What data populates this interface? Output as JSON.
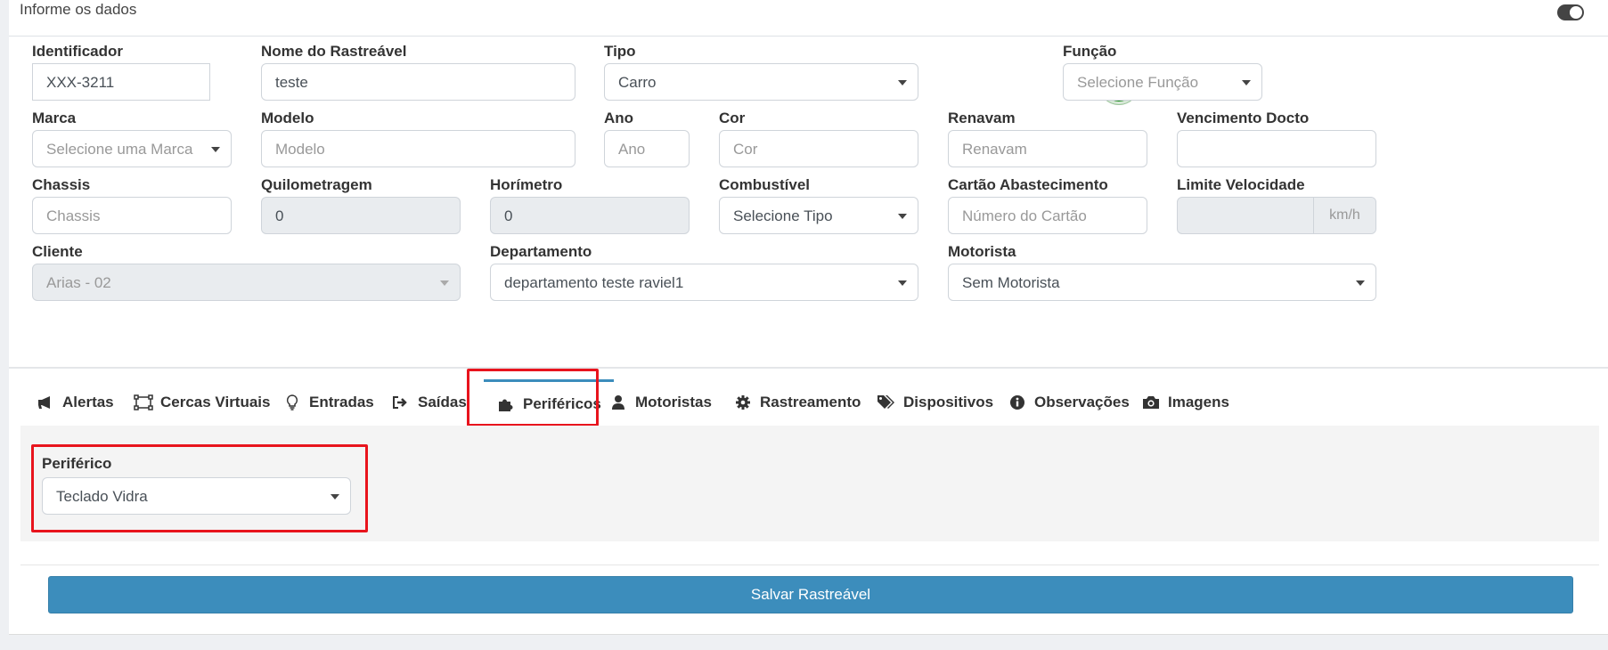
{
  "panel": {
    "title": "Informe os dados",
    "toggle_on": true
  },
  "fields": {
    "identificador": {
      "label": "Identificador",
      "value": "XXX-3211"
    },
    "nome": {
      "label": "Nome do Rastreável",
      "value": "teste"
    },
    "tipo": {
      "label": "Tipo",
      "value": "Carro"
    },
    "funcao": {
      "label": "Função",
      "placeholder": "Selecione Função"
    },
    "marca": {
      "label": "Marca",
      "placeholder": "Selecione uma Marca"
    },
    "modelo": {
      "label": "Modelo",
      "placeholder": "Modelo"
    },
    "ano": {
      "label": "Ano",
      "placeholder": "Ano"
    },
    "cor": {
      "label": "Cor",
      "placeholder": "Cor"
    },
    "renavam": {
      "label": "Renavam",
      "placeholder": "Renavam"
    },
    "vencimento": {
      "label": "Vencimento Docto",
      "value": ""
    },
    "chassis": {
      "label": "Chassis",
      "placeholder": "Chassis"
    },
    "quilometragem": {
      "label": "Quilometragem",
      "value": "0"
    },
    "horimetro": {
      "label": "Horímetro",
      "value": "0"
    },
    "combustivel": {
      "label": "Combustível",
      "value": "Selecione Tipo"
    },
    "cartao": {
      "label": "Cartão Abastecimento",
      "placeholder": "Número do Cartão"
    },
    "limite": {
      "label": "Limite Velocidade",
      "value": "",
      "unit": "km/h"
    },
    "cliente": {
      "label": "Cliente",
      "value": "Arias - 02"
    },
    "departamento": {
      "label": "Departamento",
      "value": "departamento teste raviel1"
    },
    "motorista": {
      "label": "Motorista",
      "value": "Sem Motorista"
    }
  },
  "tabs": [
    {
      "label": "Alertas",
      "icon": "bullhorn-icon"
    },
    {
      "label": "Cercas Virtuais",
      "icon": "vector-polygon-icon"
    },
    {
      "label": "Entradas",
      "icon": "lightbulb-icon"
    },
    {
      "label": "Saídas",
      "icon": "sign-out-icon"
    },
    {
      "label": "Periféricos",
      "icon": "puzzle-piece-icon",
      "active": true
    },
    {
      "label": "Motoristas",
      "icon": "user-icon"
    },
    {
      "label": "Rastreamento",
      "icon": "gear-icon"
    },
    {
      "label": "Dispositivos",
      "icon": "tags-icon"
    },
    {
      "label": "Observações",
      "icon": "info-circle-icon"
    },
    {
      "label": "Imagens",
      "icon": "camera-icon"
    }
  ],
  "periferico": {
    "label": "Periférico",
    "value": "Teclado Vidra"
  },
  "save_button": {
    "label": "Salvar Rastreável",
    "color": "#3c8dbc"
  },
  "colors": {
    "highlight": "#e8141d",
    "active_tab_border": "#3c8dbc",
    "vehicle_badge": "#118711"
  }
}
